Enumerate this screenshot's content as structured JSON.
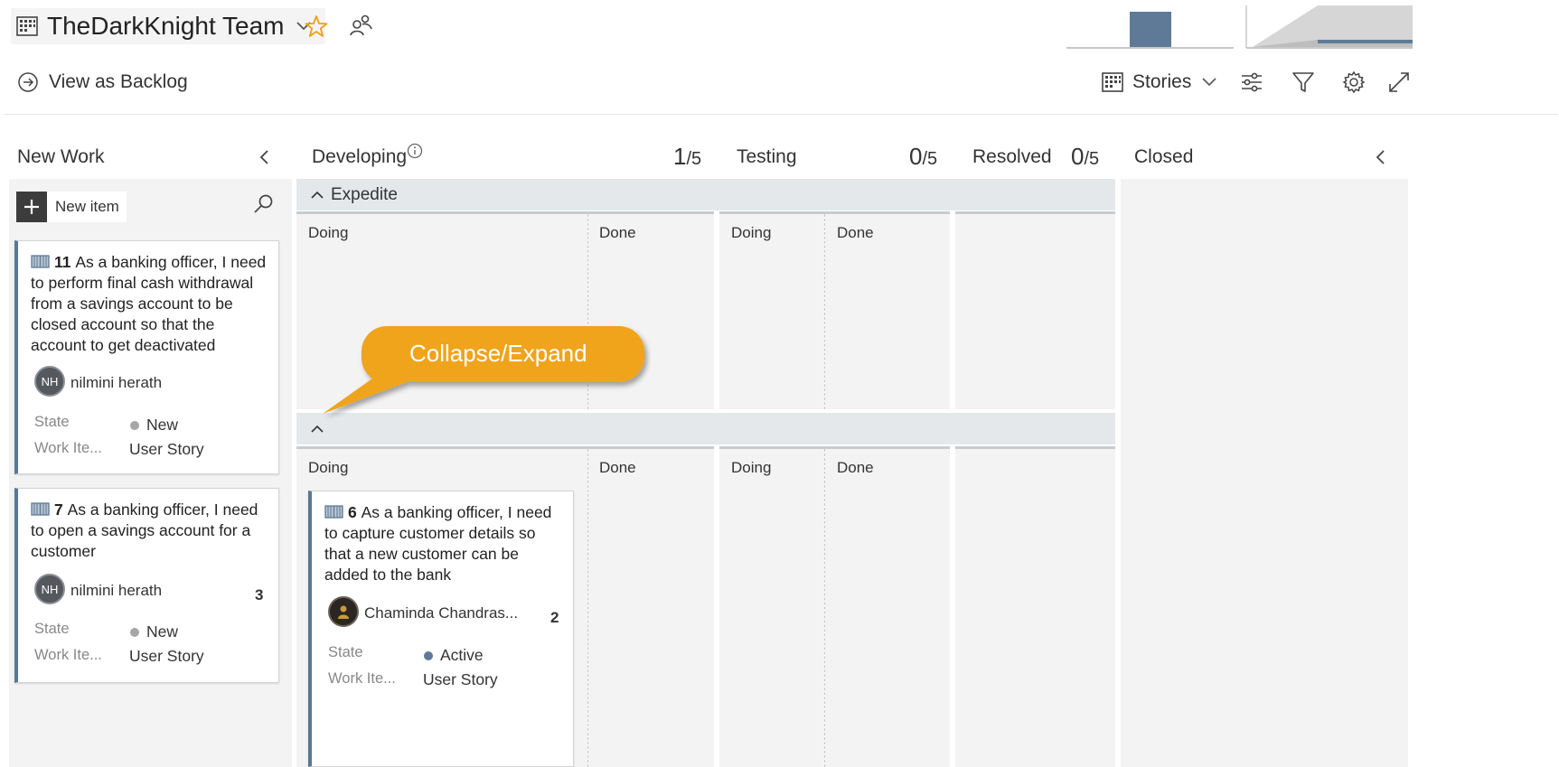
{
  "header": {
    "team_name": "TheDarkKnight Team",
    "icons": [
      "board-grid-icon",
      "chevron-down-icon",
      "star-icon",
      "people-icon"
    ]
  },
  "toolbar": {
    "view_backlog": "View as Backlog",
    "backlog_level": "Stories",
    "icons": [
      "arrow-right-circle-icon",
      "settings-sliders-icon",
      "filter-icon",
      "gear-icon",
      "fullscreen-icon"
    ]
  },
  "columns": {
    "new_work": {
      "title": "New Work"
    },
    "developing": {
      "title": "Developing",
      "count": "1",
      "limit": "/5",
      "sub": [
        "Doing",
        "Done"
      ]
    },
    "testing": {
      "title": "Testing",
      "count": "0",
      "limit": "/5",
      "sub": [
        "Doing",
        "Done"
      ]
    },
    "resolved": {
      "title": "Resolved",
      "count": "0",
      "limit": "/5"
    },
    "closed": {
      "title": "Closed"
    }
  },
  "new_item": {
    "label": "New item"
  },
  "swimlanes": {
    "expedite": "Expedite"
  },
  "cards": [
    {
      "id": "11",
      "title": "As a banking officer, I need to perform final cash withdrawal from a savings account to be closed account so that the account to get deactivated",
      "initials": "NH",
      "assignee": "nilmini herath",
      "effort": "",
      "state_label": "State",
      "state": "New",
      "type_label": "Work Ite...",
      "type": "User Story"
    },
    {
      "id": "7",
      "title": "As a banking officer, I need to open a savings account for a customer",
      "initials": "NH",
      "assignee": "nilmini herath",
      "effort": "3",
      "state_label": "State",
      "state": "New",
      "type_label": "Work Ite...",
      "type": "User Story"
    },
    {
      "id": "6",
      "title": "As a banking officer, I need to capture customer details so that a new customer can be added to the bank",
      "initials": "",
      "assignee": "Chaminda Chandras...",
      "effort": "2",
      "state_label": "State",
      "state": "Active",
      "type_label": "Work Ite...",
      "type": "User Story"
    }
  ],
  "callout": {
    "text": "Collapse/Expand"
  },
  "colors": {
    "accent_card_border": "#5a7895",
    "state_new": "#a6a6a6",
    "state_active": "#5f7a96",
    "callout": "#efa41d",
    "lane_header": "#e4e8eb",
    "panel_bg": "#f3f3f3",
    "chart_bar": "#5f7a96"
  }
}
